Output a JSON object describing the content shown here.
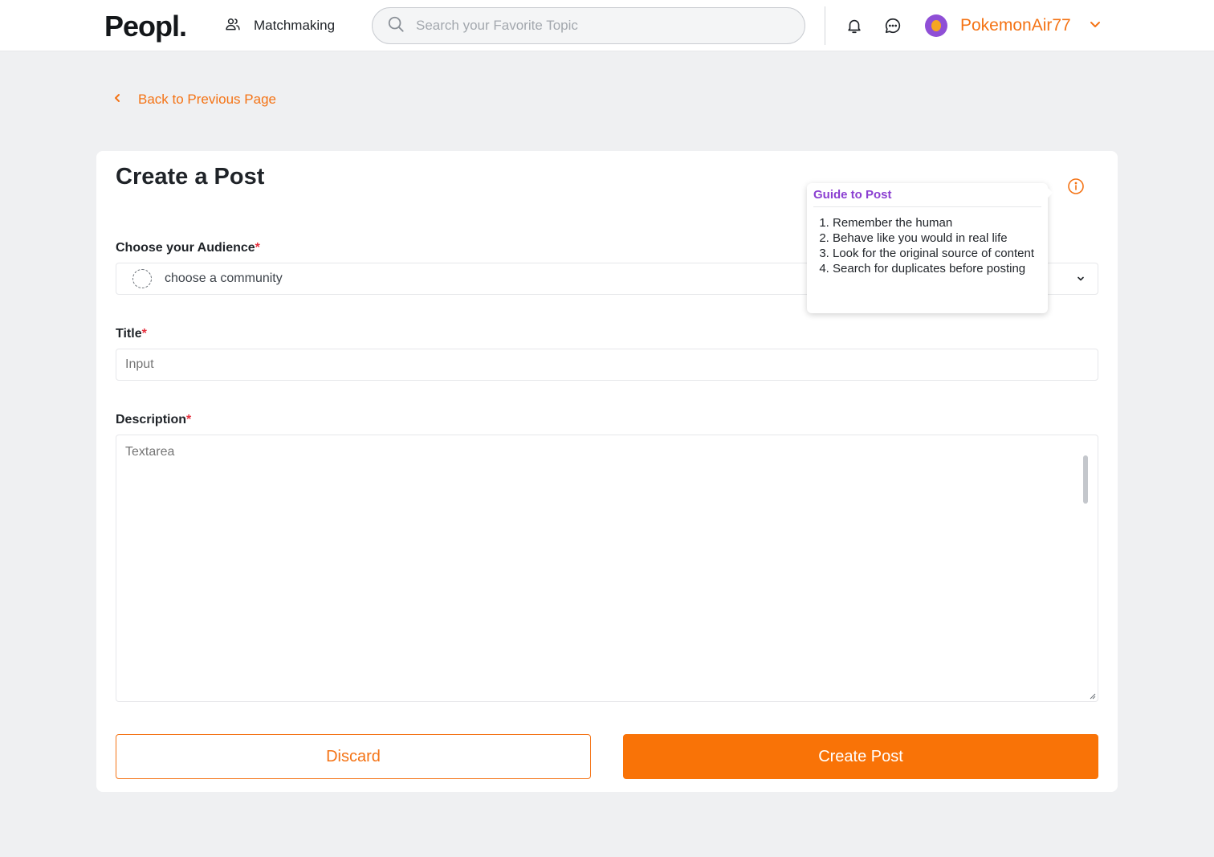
{
  "header": {
    "logo": "Peopl.",
    "nav_matchmaking": "Matchmaking",
    "search_placeholder": "Search your Favorite Topic",
    "username": "PokemonAir77"
  },
  "back_link": "Back to Previous Page",
  "form": {
    "title": "Create a Post",
    "audience_label": "Choose your Audience",
    "audience_placeholder": "choose a community",
    "title_label": "Title",
    "title_placeholder": "Input",
    "description_label": "Description",
    "description_placeholder": "Textarea",
    "required_mark": "*",
    "discard_label": "Discard",
    "create_label": "Create Post"
  },
  "guide": {
    "title": "Guide to Post",
    "items": [
      "Remember the human",
      "Behave like you would in real life",
      "Look for the original source of content",
      "Search for duplicates before posting"
    ]
  },
  "colors": {
    "accent": "#f47315",
    "primary_button": "#f97307",
    "guide_title": "#8b3fd1",
    "required": "#e5303e",
    "background": "#eff0f2"
  },
  "icons": [
    "users-icon",
    "search-icon",
    "bell-icon",
    "chat-icon",
    "avatar",
    "chevron-down-icon",
    "chevron-left-icon",
    "info-icon",
    "community-placeholder-icon"
  ]
}
